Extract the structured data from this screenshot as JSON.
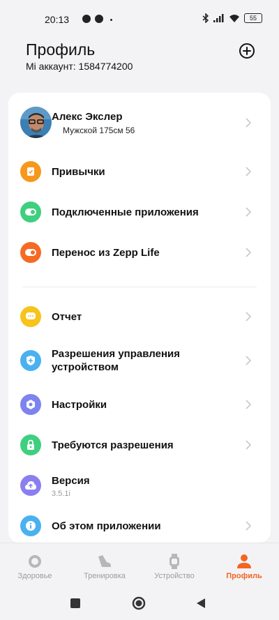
{
  "status_bar": {
    "time": "20:13",
    "battery": "55"
  },
  "header": {
    "title": "Профиль",
    "account": "Mi аккаунт: 1584774200"
  },
  "profile": {
    "name": "Алекс Экслер",
    "details": "Мужской  175см  56"
  },
  "menu": {
    "habits": "Привычки",
    "connected_apps": "Подключенные приложения",
    "zepp_transfer": "Перенос из Zepp Life",
    "report": "Отчет",
    "device_permissions": "Разрешения управления устройством",
    "settings": "Настройки",
    "permissions_required": "Требуются разрешения",
    "version": "Версия",
    "version_number": "3.5.1i",
    "about": "Об этом приложении"
  },
  "icon_colors": {
    "habits": "#f6981e",
    "connected_apps": "#3fcf7f",
    "zepp_transfer": "#f66a24",
    "report": "#f8c31b",
    "device_permissions": "#4ab1f0",
    "settings": "#7d83ef",
    "permissions_required": "#3fcf7f",
    "version": "#8b7ff0",
    "about": "#4ab1f0"
  },
  "bottom_nav": {
    "health": "Здоровье",
    "workouts": "Тренировка",
    "device": "Устройство",
    "profile": "Профиль",
    "active": "profile",
    "active_color": "#f26523"
  }
}
